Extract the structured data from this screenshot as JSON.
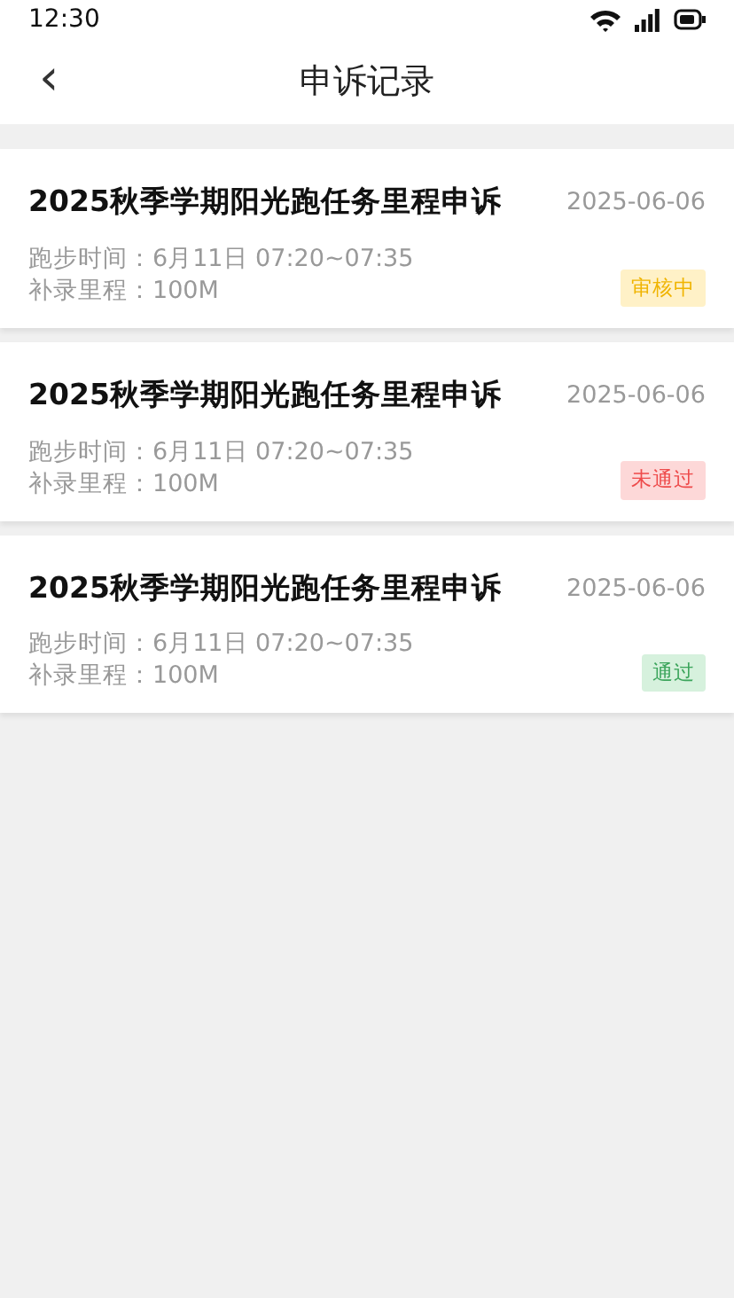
{
  "status_bar": {
    "time": "12:30"
  },
  "header": {
    "back": "‹",
    "title": "申诉记录"
  },
  "records": [
    {
      "title": "2025秋季学期阳光跑任务里程申诉",
      "date": "2025-06-06",
      "run_time": "跑步时间：6月11日 07:20~07:35",
      "distance": "补录里程：100M",
      "status": {
        "kind": "pending",
        "label": "审核中"
      }
    },
    {
      "title": "2025秋季学期阳光跑任务里程申诉",
      "date": "2025-06-06",
      "run_time": "跑步时间：6月11日 07:20~07:35",
      "distance": "补录里程：100M",
      "status": {
        "kind": "rejected",
        "label": "未通过"
      }
    },
    {
      "title": "2025秋季学期阳光跑任务里程申诉",
      "date": "2025-06-06",
      "run_time": "跑步时间：6月11日 07:20~07:35",
      "distance": "补录里程：100M",
      "status": {
        "kind": "approved",
        "label": "通过"
      }
    }
  ]
}
